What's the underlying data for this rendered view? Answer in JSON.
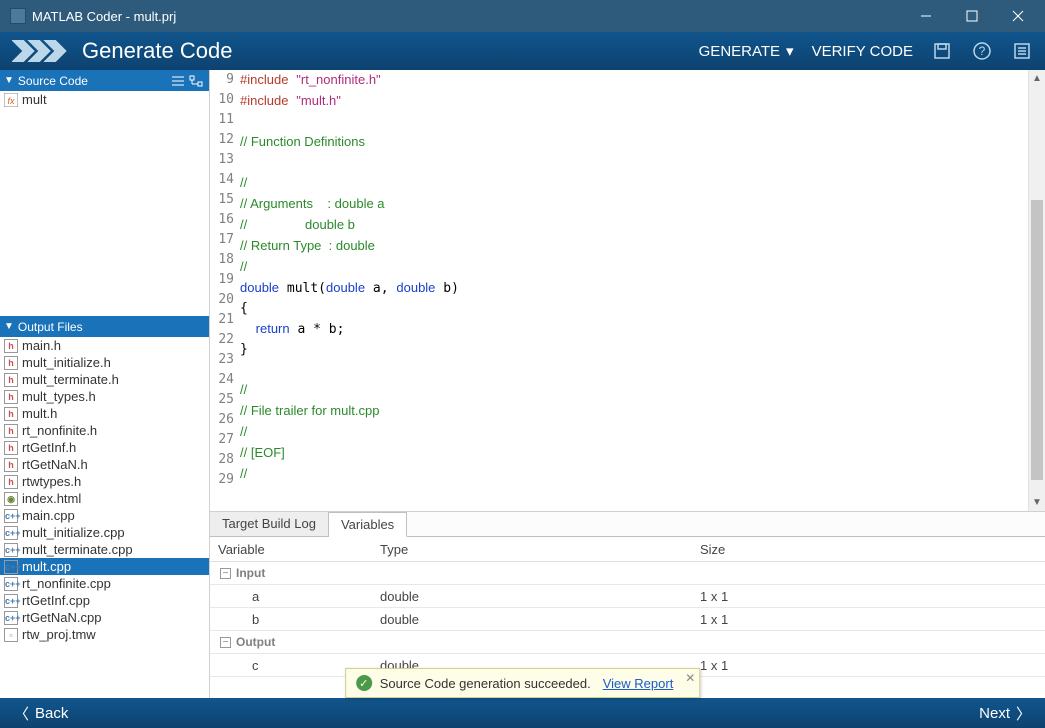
{
  "window": {
    "title": "MATLAB Coder - mult.prj"
  },
  "header": {
    "title": "Generate Code",
    "generate": "GENERATE",
    "verify": "VERIFY CODE"
  },
  "panels": {
    "source": {
      "title": "Source Code",
      "items": [
        {
          "label": "mult"
        }
      ]
    },
    "output": {
      "title": "Output Files",
      "items": [
        {
          "label": "main.h",
          "kind": "h"
        },
        {
          "label": "mult_initialize.h",
          "kind": "h"
        },
        {
          "label": "mult_terminate.h",
          "kind": "h"
        },
        {
          "label": "mult_types.h",
          "kind": "h"
        },
        {
          "label": "mult.h",
          "kind": "h"
        },
        {
          "label": "rt_nonfinite.h",
          "kind": "h"
        },
        {
          "label": "rtGetInf.h",
          "kind": "h"
        },
        {
          "label": "rtGetNaN.h",
          "kind": "h"
        },
        {
          "label": "rtwtypes.h",
          "kind": "h"
        },
        {
          "label": "index.html",
          "kind": "w"
        },
        {
          "label": "main.cpp",
          "kind": "c"
        },
        {
          "label": "mult_initialize.cpp",
          "kind": "c"
        },
        {
          "label": "mult_terminate.cpp",
          "kind": "c"
        },
        {
          "label": "mult.cpp",
          "kind": "c",
          "sel": true
        },
        {
          "label": "rt_nonfinite.cpp",
          "kind": "c"
        },
        {
          "label": "rtGetInf.cpp",
          "kind": "c"
        },
        {
          "label": "rtGetNaN.cpp",
          "kind": "c"
        },
        {
          "label": "rtw_proj.tmw",
          "kind": "f"
        }
      ]
    }
  },
  "code_first_line": 9,
  "tabs": {
    "build_log": "Target Build Log",
    "variables": "Variables"
  },
  "var_headers": {
    "v": "Variable",
    "t": "Type",
    "s": "Size"
  },
  "var_groups": {
    "input": {
      "label": "Input",
      "rows": [
        {
          "v": "a",
          "t": "double",
          "s": "1 x 1"
        },
        {
          "v": "b",
          "t": "double",
          "s": "1 x 1"
        }
      ]
    },
    "output": {
      "label": "Output",
      "rows": [
        {
          "v": "c",
          "t": "double",
          "s": "1 x 1"
        }
      ]
    }
  },
  "toast": {
    "msg": "Source Code generation succeeded.",
    "link": "View Report"
  },
  "footer": {
    "back": "Back",
    "next": "Next"
  }
}
